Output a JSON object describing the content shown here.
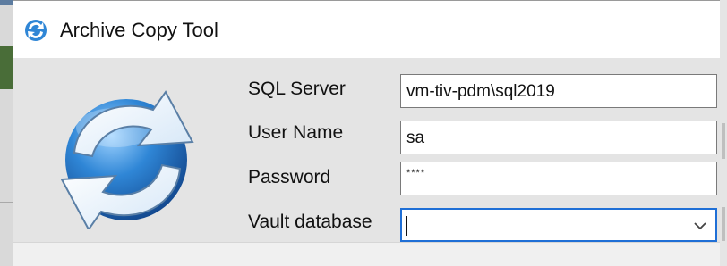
{
  "window": {
    "title": "Archive Copy Tool",
    "title_icon": "sync-arrows-icon"
  },
  "logo": {
    "icon": "sync-arrows-icon",
    "colors": {
      "blue": "#2f86d6",
      "blue_dark": "#1c5fa8",
      "arrows": "#ffffff"
    }
  },
  "form": {
    "sql_server": {
      "label": "SQL Server",
      "value": "vm-tiv-pdm\\sql2019"
    },
    "user_name": {
      "label": "User Name",
      "value": "sa"
    },
    "password": {
      "label": "Password",
      "value": "****"
    },
    "vault_database": {
      "label": "Vault database",
      "value": "",
      "dropdown_icon": "chevron-down-icon"
    }
  },
  "colors": {
    "focus_border": "#1f6fd6",
    "client_background": "#e4e4e4"
  }
}
